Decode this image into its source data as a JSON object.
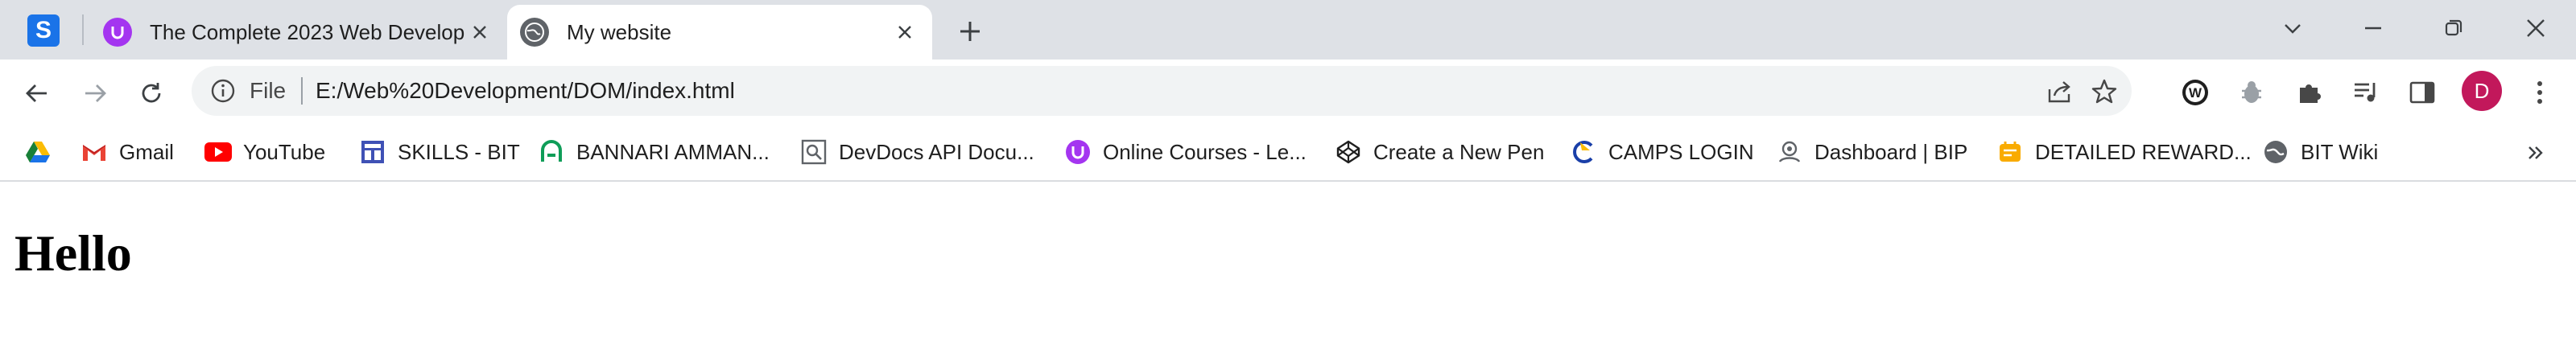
{
  "colors": {
    "tabstrip_bg": "#dee1e6",
    "accent": "#1a73e8",
    "avatar_bg": "#c2185b",
    "udemy": "#a435f0"
  },
  "tabs": {
    "pinned_letter": "S",
    "items": [
      {
        "title": "The Complete 2023 Web Develop",
        "icon": "udemy-icon",
        "active": false
      },
      {
        "title": "My website",
        "icon": "globe-icon",
        "active": true
      }
    ]
  },
  "omnibox": {
    "scheme_label": "File",
    "url": "E:/Web%20Development/DOM/index.html"
  },
  "profile": {
    "initial": "D"
  },
  "bookmarks": [
    {
      "label": "",
      "icon": "google-drive-icon"
    },
    {
      "label": "Gmail",
      "icon": "gmail-icon"
    },
    {
      "label": "YouTube",
      "icon": "youtube-icon"
    },
    {
      "label": "SKILLS - BIT",
      "icon": "skills-icon"
    },
    {
      "label": "BANNARI AMMAN...",
      "icon": "bannari-icon"
    },
    {
      "label": "DevDocs API Docu...",
      "icon": "devdocs-icon"
    },
    {
      "label": "Online Courses - Le...",
      "icon": "udemy-icon"
    },
    {
      "label": "Create a New Pen",
      "icon": "codepen-icon"
    },
    {
      "label": "CAMPS LOGIN",
      "icon": "camps-icon"
    },
    {
      "label": "Dashboard | BIP",
      "icon": "bip-icon"
    },
    {
      "label": "DETAILED REWARD...",
      "icon": "reward-icon"
    },
    {
      "label": "BIT Wiki",
      "icon": "globe-icon"
    }
  ],
  "page": {
    "heading": "Hello"
  }
}
